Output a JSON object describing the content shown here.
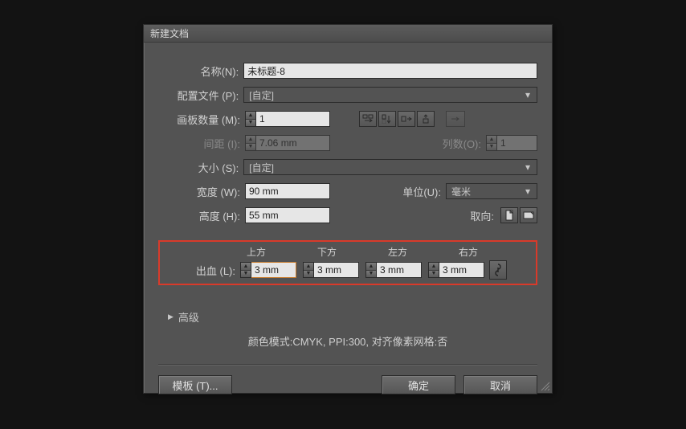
{
  "title": "新建文档",
  "labels": {
    "name": "名称(N):",
    "profile": "配置文件 (P):",
    "artboards": "画板数量 (M):",
    "spacing": "间距 (I):",
    "columns": "列数(O):",
    "size": "大小 (S):",
    "width": "宽度 (W):",
    "height": "高度 (H):",
    "units": "单位(U):",
    "orientation": "取向:",
    "bleed": "出血 (L):",
    "advanced": "高级",
    "templates": "模板 (T)...",
    "ok": "确定",
    "cancel": "取消"
  },
  "values": {
    "name": "未标题-8",
    "profile": "[自定]",
    "artboards": "1",
    "spacing": "7.06 mm",
    "columns": "1",
    "size": "[自定]",
    "width": "90 mm",
    "height": "55 mm",
    "units": "毫米"
  },
  "bleed": {
    "headers": {
      "top": "上方",
      "bottom": "下方",
      "left": "左方",
      "right": "右方"
    },
    "top": "3 mm",
    "bottom": "3 mm",
    "left": "3 mm",
    "right": "3 mm"
  },
  "info": "颜色模式:CMYK, PPI:300, 对齐像素网格:否"
}
